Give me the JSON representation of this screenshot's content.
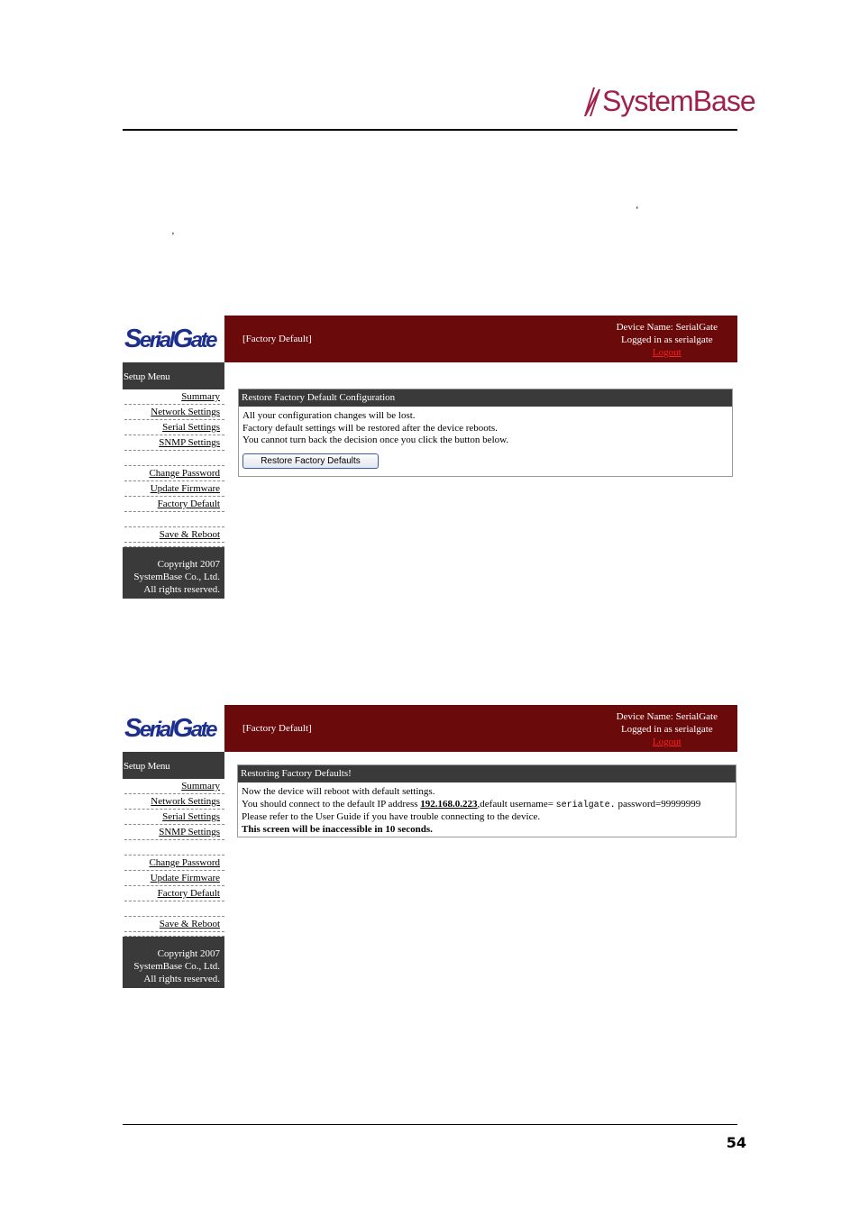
{
  "page": {
    "brand": "SystemBase",
    "page_number": "54",
    "open_quote": "‘",
    "close_quote": "’"
  },
  "app": {
    "logo_s": "S",
    "logo_erial": "erial",
    "logo_g": "G",
    "logo_ate": "ate",
    "breadcrumb": "[Factory Default]",
    "device_name": "Device Name: SerialGate",
    "logged_in": "Logged in as serialgate",
    "logout": "Logout",
    "menu_title": "Setup Menu",
    "menu": {
      "summary": "Summary",
      "network": "Network Settings",
      "serial": "Serial Settings",
      "snmp": "SNMP Settings",
      "password": "Change Password",
      "firmware": "Update Firmware",
      "factory": "Factory Default",
      "save": "Save & Reboot"
    },
    "copyright_1": "Copyright 2007",
    "copyright_2": "SystemBase Co., Ltd.",
    "copyright_3": "All rights reserved."
  },
  "screen1": {
    "panel_title": "Restore Factory Default Configuration",
    "line1": "All your configuration changes will be lost.",
    "line2": "Factory default settings will be restored after the device reboots.",
    "line3": "You cannot turn back the decision once you click the button below.",
    "button": "Restore Factory Defaults"
  },
  "screen2": {
    "panel_title": "Restoring Factory Defaults!",
    "line1": "Now the device will reboot with default settings.",
    "line2_pre": "You should connect to the default IP address ",
    "ip": "192.168.0.223",
    "line2_mid": ",default username= ",
    "username": "serialgate.",
    "line2_post": " password=99999999",
    "line3": "Please refer to the User Guide if you have trouble connecting to the device.",
    "line4_pre": "This screen will be inaccessible ",
    "line4_bold": "in 10 seconds."
  }
}
